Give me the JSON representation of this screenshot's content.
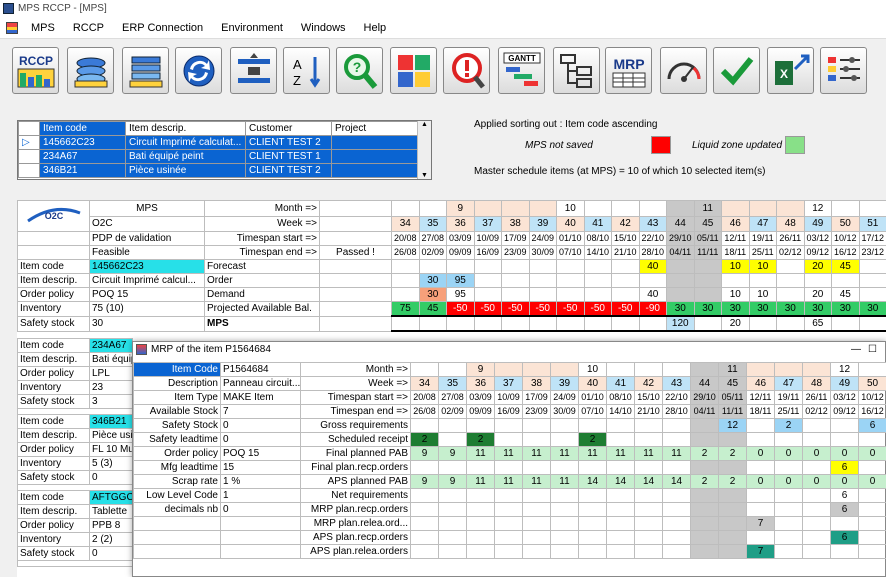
{
  "window": {
    "title": "MPS RCCP - [MPS]"
  },
  "menu": [
    "MPS",
    "RCCP",
    "ERP Connection",
    "Environment",
    "Windows",
    "Help"
  ],
  "toolbar": [
    "rccp",
    "stack-layers",
    "stack-layers-2",
    "refresh",
    "merge-split",
    "sort-az",
    "search",
    "puzzle",
    "alert",
    "gantt",
    "tree",
    "mrp",
    "gauge",
    "check",
    "excel-export",
    "settings"
  ],
  "item_list": {
    "headers": [
      "Item code",
      "Item descrip.",
      "Customer",
      "Project"
    ],
    "rows": [
      [
        "145662C23",
        "Circuit Imprimé calculat...",
        "CLIENT TEST 2",
        ""
      ],
      [
        "234A67",
        "Bati équipé peint",
        "CLIENT TEST 1",
        ""
      ],
      [
        "346B21",
        "Pièce usinée",
        "CLIENT TEST 2",
        ""
      ]
    ]
  },
  "info": {
    "sorting": "Applied sorting out : Item code ascending",
    "not_saved": "MPS not saved",
    "liquid": "Liquid zone updated",
    "master": "Master schedule items (at MPS) = 10 of which 10 selected item(s)",
    "not_saved_color": "#ff0000",
    "liquid_color": "#88e088"
  },
  "mps": {
    "title": "MPS",
    "o2c": "O2C",
    "pdp": "PDP de validation",
    "feasible": "Feasible",
    "passed": "Passed !",
    "month_lbl": "Month =>",
    "week_lbl": "Week =>",
    "start_lbl": "Timespan start =>",
    "end_lbl": "Timespan end =>",
    "months": [
      "",
      "",
      "9",
      "",
      "",
      "",
      "10",
      "",
      "",
      "",
      "",
      "11",
      "",
      "",
      "",
      "12",
      "",
      ""
    ],
    "weeks": [
      "34",
      "35",
      "36",
      "37",
      "38",
      "39",
      "40",
      "41",
      "42",
      "43",
      "44",
      "45",
      "46",
      "47",
      "48",
      "49",
      "50",
      "51"
    ],
    "starts": [
      "20/08",
      "27/08",
      "03/09",
      "10/09",
      "17/09",
      "24/09",
      "01/10",
      "08/10",
      "15/10",
      "22/10",
      "29/10",
      "05/11",
      "12/11",
      "19/11",
      "26/11",
      "03/12",
      "10/12",
      "17/12"
    ],
    "ends": [
      "26/08",
      "02/09",
      "09/09",
      "16/09",
      "23/09",
      "30/09",
      "07/10",
      "14/10",
      "21/10",
      "28/10",
      "04/11",
      "11/11",
      "18/11",
      "25/11",
      "02/12",
      "09/12",
      "16/12",
      "23/12"
    ],
    "attrs": [
      [
        "Item code",
        "145662C23"
      ],
      [
        "Item descrip.",
        "Circuit Imprimé calcul..."
      ],
      [
        "Order policy",
        "POQ 15"
      ],
      [
        "Inventory",
        "75 (10)"
      ],
      [
        "Safety stock",
        "30"
      ]
    ],
    "rowlabels": [
      "Forecast",
      "Order",
      "Demand",
      "Projected Available Bal.",
      "MPS"
    ],
    "forecast": [
      "",
      "",
      "",
      "",
      "",
      "",
      "",
      "",
      "",
      "40",
      "",
      "",
      "10",
      "10",
      "",
      "20",
      "45",
      ""
    ],
    "order": [
      "",
      "30",
      "95",
      "",
      "",
      "",
      "",
      "",
      "",
      "",
      "",
      "",
      "",
      "",
      "",
      "",
      "",
      ""
    ],
    "demand": [
      "",
      "30",
      "95",
      "",
      "",
      "",
      "",
      "",
      "",
      "40",
      "",
      "",
      "10",
      "10",
      "",
      "20",
      "45",
      ""
    ],
    "pab": [
      "75",
      "45",
      "-50",
      "-50",
      "-50",
      "-50",
      "-50",
      "-50",
      "-50",
      "-90",
      "30",
      "30",
      "30",
      "30",
      "30",
      "30",
      "30",
      "30"
    ],
    "mpsrow": [
      "",
      "",
      "",
      "",
      "",
      "",
      "",
      "",
      "",
      "",
      "120",
      "",
      "20",
      "",
      "",
      "65",
      "",
      ""
    ]
  },
  "items_below": [
    {
      "attrs": [
        [
          "Item code",
          "234A67"
        ],
        [
          "Item descrip.",
          "Bati équipé"
        ],
        [
          "Order policy",
          "LPL"
        ],
        [
          "Inventory",
          "23"
        ],
        [
          "Safety stock",
          "3"
        ]
      ]
    },
    {
      "attrs": [
        [
          "Item code",
          "346B21"
        ],
        [
          "Item descrip.",
          "Pièce usi"
        ],
        [
          "Order policy",
          "FL 10 Mu"
        ],
        [
          "Inventory",
          "5 (3)"
        ],
        [
          "Safety stock",
          "0"
        ]
      ]
    },
    {
      "attrs": [
        [
          "Item code",
          "AFTGGC"
        ],
        [
          "Item descrip.",
          "Tablette"
        ],
        [
          "Order policy",
          "PPB 8"
        ],
        [
          "Inventory",
          "2 (2)"
        ],
        [
          "Safety stock",
          "0"
        ]
      ]
    }
  ],
  "mrp": {
    "title": "MRP of the item P1564684",
    "attrs": [
      [
        "Item Code",
        "P1564684"
      ],
      [
        "Description",
        "Panneau circuit..."
      ],
      [
        "Item Type",
        "MAKE Item"
      ],
      [
        "Available Stock",
        "7"
      ],
      [
        "Safety Stock",
        "0"
      ],
      [
        "Safety leadtime",
        "0"
      ],
      [
        "Order policy",
        "POQ 15"
      ],
      [
        "Mfg leadtime",
        "15"
      ],
      [
        "Scrap rate",
        "1 %"
      ],
      [
        "Low Level Code",
        "1"
      ],
      [
        "decimals nb",
        "0"
      ]
    ],
    "months": [
      "",
      "",
      "9",
      "",
      "",
      "",
      "10",
      "",
      "",
      "",
      "",
      "11",
      "",
      "",
      "",
      "12",
      ""
    ],
    "weeks": [
      "34",
      "35",
      "36",
      "37",
      "38",
      "39",
      "40",
      "41",
      "42",
      "43",
      "44",
      "45",
      "46",
      "47",
      "48",
      "49",
      "50"
    ],
    "starts": [
      "20/08",
      "27/08",
      "03/09",
      "10/09",
      "17/09",
      "24/09",
      "01/10",
      "08/10",
      "15/10",
      "22/10",
      "29/10",
      "05/11",
      "12/11",
      "19/11",
      "26/11",
      "03/12",
      "10/12"
    ],
    "ends": [
      "26/08",
      "02/09",
      "09/09",
      "16/09",
      "23/09",
      "30/09",
      "07/10",
      "14/10",
      "21/10",
      "28/10",
      "04/11",
      "11/11",
      "18/11",
      "25/11",
      "02/12",
      "09/12",
      "16/12"
    ],
    "month_lbl": "Month =>",
    "week_lbl": "Week =>",
    "start_lbl": "Timespan start =>",
    "end_lbl": "Timespan end =>",
    "rows": [
      {
        "label": "Gross requirements",
        "v": [
          "",
          "",
          "",
          "",
          "",
          "",
          "",
          "",
          "",
          "",
          "",
          "12",
          "",
          "2",
          "",
          "",
          "6",
          ""
        ]
      },
      {
        "label": "Scheduled receipt",
        "v": [
          "2",
          "",
          "2",
          "",
          "",
          "",
          "2",
          "",
          "",
          "",
          "",
          "",
          "",
          "",
          "",
          "",
          "",
          ""
        ]
      },
      {
        "label": "Final planned PAB",
        "v": [
          "9",
          "9",
          "11",
          "11",
          "11",
          "11",
          "11",
          "11",
          "11",
          "11",
          "2",
          "2",
          "0",
          "0",
          "0",
          "0",
          "0"
        ]
      },
      {
        "label": "Final plan.recp.orders",
        "v": [
          "",
          "",
          "",
          "",
          "",
          "",
          "",
          "",
          "",
          "",
          "",
          "",
          "",
          "",
          "",
          "6",
          ""
        ]
      },
      {
        "label": "APS planned PAB",
        "v": [
          "9",
          "9",
          "11",
          "11",
          "11",
          "11",
          "14",
          "14",
          "14",
          "14",
          "2",
          "2",
          "0",
          "0",
          "0",
          "0",
          "0"
        ]
      },
      {
        "label": "Net requirements",
        "v": [
          "",
          "",
          "",
          "",
          "",
          "",
          "",
          "",
          "",
          "",
          "",
          "",
          "",
          "",
          "",
          "6",
          ""
        ]
      },
      {
        "label": "MRP plan.recp.orders",
        "v": [
          "",
          "",
          "",
          "",
          "",
          "",
          "",
          "",
          "",
          "",
          "",
          "",
          "",
          "",
          "",
          "6",
          ""
        ]
      },
      {
        "label": "MRP plan.relea.ord...",
        "v": [
          "",
          "",
          "",
          "",
          "",
          "",
          "",
          "",
          "",
          "",
          "",
          "",
          "7",
          "",
          "",
          "",
          ""
        ]
      },
      {
        "label": "APS plan.recp.orders",
        "v": [
          "",
          "",
          "",
          "",
          "",
          "",
          "",
          "",
          "",
          "",
          "",
          "",
          "",
          "",
          "",
          "6",
          ""
        ]
      },
      {
        "label": "APS plan.relea.orders",
        "v": [
          "",
          "",
          "",
          "",
          "",
          "",
          "",
          "",
          "",
          "",
          "",
          "",
          "7",
          "",
          "",
          "",
          ""
        ]
      }
    ]
  }
}
